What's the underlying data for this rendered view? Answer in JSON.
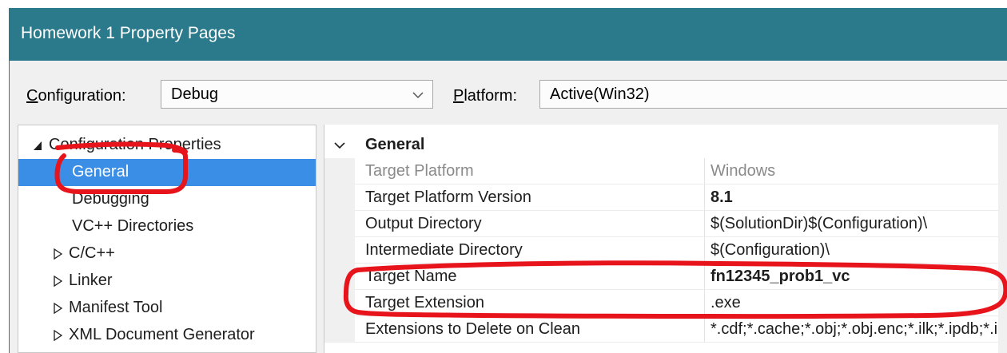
{
  "window": {
    "title": "Homework 1 Property Pages"
  },
  "toolbar": {
    "configuration_label_ul": "C",
    "configuration_label_rest": "onfiguration:",
    "configuration_value": "Debug",
    "platform_label_ul": "P",
    "platform_label_rest": "latform:",
    "platform_value": "Active(Win32)"
  },
  "tree": {
    "root": "Configuration Properties",
    "items": [
      {
        "label": "General",
        "selected": true
      },
      {
        "label": "Debugging"
      },
      {
        "label": "VC++ Directories"
      },
      {
        "label": "C/C++",
        "expandable": true
      },
      {
        "label": "Linker",
        "expandable": true
      },
      {
        "label": "Manifest Tool",
        "expandable": true
      },
      {
        "label": "XML Document Generator",
        "expandable": true
      }
    ]
  },
  "grid": {
    "section": "General",
    "rows": [
      {
        "name": "Target Platform",
        "value": "Windows",
        "disabled": true
      },
      {
        "name": "Target Platform Version",
        "value": "8.1",
        "bold": true
      },
      {
        "name": "Output Directory",
        "value": "$(SolutionDir)$(Configuration)\\"
      },
      {
        "name": "Intermediate Directory",
        "value": "$(Configuration)\\"
      },
      {
        "name": "Target Name",
        "value": "fn12345_prob1_vc",
        "bold": true
      },
      {
        "name": "Target Extension",
        "value": ".exe"
      },
      {
        "name": "Extensions to Delete on Clean",
        "value": "*.cdf;*.cache;*.obj;*.obj.enc;*.ilk;*.ipdb;*.iobj;*.resources;*.tlb;*.tli;*.tlh;*.tmp;*.rsp"
      }
    ]
  },
  "colors": {
    "titlebar": "#2b7a8c",
    "selection": "#3a8ee6",
    "annotation": "#e8141c"
  },
  "icons": {
    "expanded": "filled-down-right-triangle-icon",
    "collapsed": "hollow-right-triangle-icon",
    "section_toggle": "chevron-down-icon",
    "combo": "chevron-down-icon"
  }
}
